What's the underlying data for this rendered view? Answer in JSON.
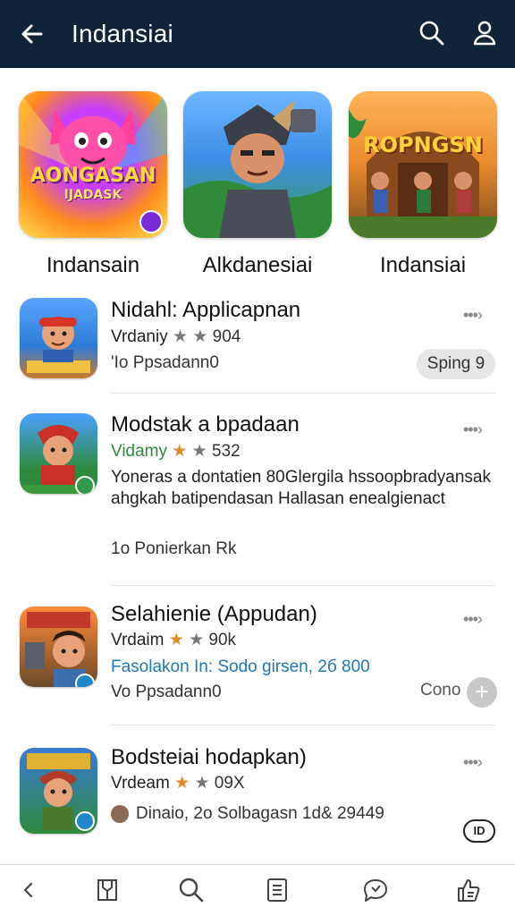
{
  "header": {
    "title": "Indansiai",
    "back_icon": "back-arrow-icon",
    "search_icon": "search-icon",
    "profile_icon": "person-icon"
  },
  "featured": [
    {
      "label": "Indansain",
      "tile_text_1": "AONGASAN",
      "tile_text_2": "IJADASK"
    },
    {
      "label": "Alkdanesiai"
    },
    {
      "label": "Indansiai",
      "tile_text_1": "ROPNGSN"
    }
  ],
  "apps": [
    {
      "name": "Nidahl: Applicapnan",
      "developer": "Vrdaniy",
      "rating_count": "904",
      "subtitle": "'Io Ppsadann0",
      "action": "Sping 9"
    },
    {
      "name": "Modstak a bpadaan",
      "developer": "Vidamy",
      "rating_count": "532",
      "description": "Yoneras a dontatien 80Glergila hssoopbradyansak ahgkah batipendasan Hallasan enealgienact",
      "subtitle": "1o Ponierkan Rk"
    },
    {
      "name": "Selahienie (Appudan)",
      "developer": "Vrdaim",
      "rating_count": "90k",
      "link_text": "Fasolakon In: Sodo girsen, 2б 800",
      "subtitle": "Vo Ppsadann0",
      "action": "Cono"
    },
    {
      "name": "Bodsteiai hodapkan)",
      "developer": "Vrdeam",
      "rating_count": "09X",
      "subtitle": "Dinaio, 2o Solbagasn 1d& 29449",
      "badge": "ID"
    }
  ],
  "colors": {
    "header_bg": "#0f2438",
    "star_on": "#e08a2a",
    "link": "#1e78b4",
    "dev_green": "#2e8b3d"
  },
  "bottom_nav": [
    "back-chevron-icon",
    "map-icon",
    "search-icon",
    "document-icon",
    "chat-icon",
    "thumbs-up-icon"
  ]
}
